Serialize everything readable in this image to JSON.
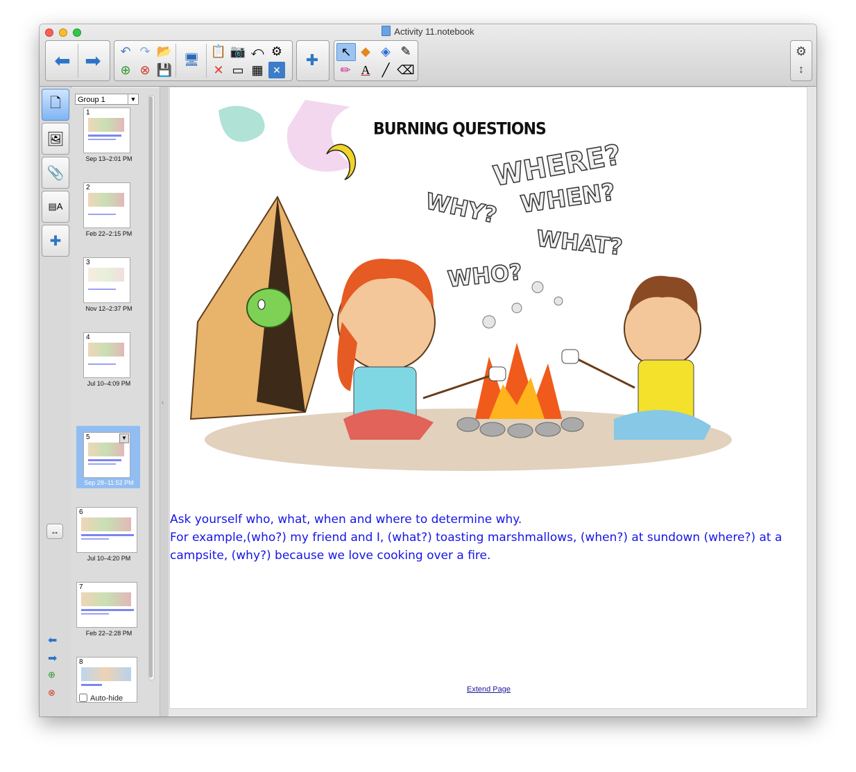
{
  "window": {
    "title": "Activity 11.notebook"
  },
  "toolbar": {
    "back_icon": "arrow-left-icon",
    "forward_icon": "arrow-right-icon"
  },
  "sorter": {
    "group_label": "Group 1",
    "pages": [
      {
        "num": "1",
        "label": "Sep 13–2:01 PM"
      },
      {
        "num": "2",
        "label": "Feb 22–2:15 PM"
      },
      {
        "num": "3",
        "label": "Nov 12–2:37 PM"
      },
      {
        "num": "4",
        "label": "Jul 10–4:09 PM"
      },
      {
        "num": "5",
        "label": "Sep 28–11:52 PM"
      },
      {
        "num": "6",
        "label": "Jul 10–4:20 PM"
      },
      {
        "num": "7",
        "label": "Feb 22–2:28 PM"
      },
      {
        "num": "8",
        "label": ""
      }
    ],
    "autohide_label": "Auto-hide"
  },
  "page": {
    "illustration_title": "BURNING QUESTIONS",
    "bubbles": [
      "WHERE?",
      "WHEN?",
      "WHY?",
      "WHAT?",
      "WHO?"
    ],
    "caption_line1": "Ask yourself who, what, when and where to determine why.",
    "caption_line2": "For example,(who?) my friend and I, (what?) toasting marshmallows, (when?) at sundown (where?) at a campsite, (why?) because we love cooking over a fire.",
    "extend_link": "Extend Page"
  },
  "colors": {
    "caption": "#1515e6",
    "selected": "#91bdf2"
  }
}
